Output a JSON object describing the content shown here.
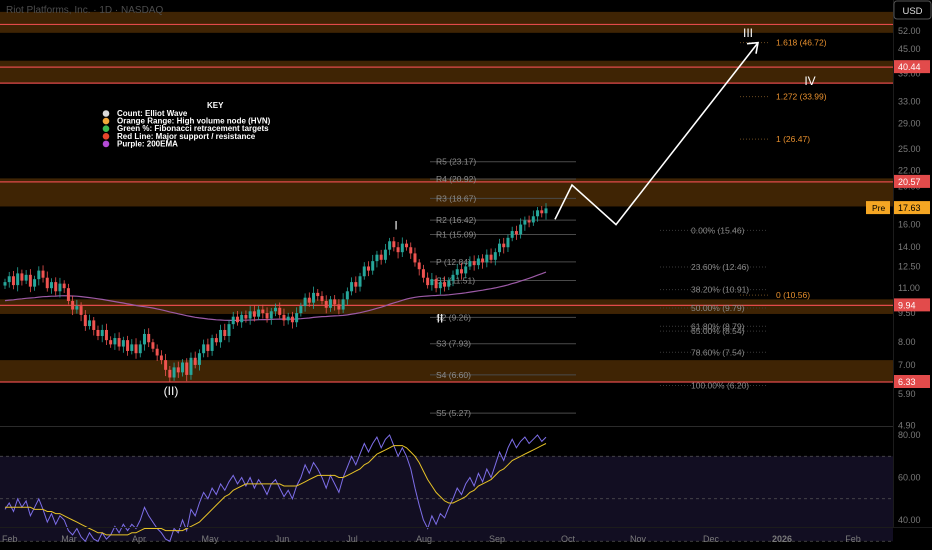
{
  "header": {
    "title": "Riot Platforms, Inc. · 1D · NASDAQ",
    "currency": "USD"
  },
  "key": {
    "title": "KEY",
    "items": [
      {
        "label": "Count: Elliot Wave",
        "color": "#d9d9d9"
      },
      {
        "label": "Orange Range: High volume node (HVN)",
        "color": "#f2a83a"
      },
      {
        "label": "Green %: Fibonacci retracement targets",
        "color": "#3fb950"
      },
      {
        "label": "Red Line: Major support / resistance",
        "color": "#e8452c"
      },
      {
        "label": "Purple: 200EMA",
        "color": "#b44ad6"
      }
    ]
  },
  "colors": {
    "background": "#000000",
    "zone_fill": "#4a2a05",
    "support_line": "#e14a4a",
    "up_candle": "#26a69a",
    "down_candle": "#ef5350",
    "ema": "#9c5aa6",
    "fib_text": "#8a8a8a",
    "ext_text": "#e8902e",
    "pivot_text": "#8c8c8c",
    "wave_text": "#ffffff",
    "rsi_line": "#7d6ee8",
    "rsi_ma": "#e6c227",
    "rsi_band": "#140f26"
  },
  "chart_data": {
    "type": "candlestick",
    "y_scale": "log",
    "ylim": [
      4.3,
      56
    ],
    "x_ticks": [
      "Feb",
      "Mar",
      "Apr",
      "May",
      "Jun",
      "Jul",
      "Aug",
      "Sep",
      "Oct",
      "Nov",
      "Dec",
      "2026",
      "Feb"
    ],
    "y_ticks": [
      50.0,
      45.0,
      39.0,
      33.0,
      29.0,
      25.0,
      22.0,
      20.0,
      17.5,
      16.0,
      14.0,
      12.5,
      11.0,
      9.5,
      8.0,
      7.0,
      5.9,
      4.9
    ],
    "y_tick_labels": [
      "52.00",
      "45.00",
      "39.00",
      "33.00",
      "29.00",
      "25.00",
      "22.00",
      "20.00",
      "17.50",
      "16.00",
      "14.00",
      "12.50",
      "11.00",
      "9.50",
      "8.00",
      "7.00",
      "5.90",
      "4.90"
    ],
    "price_tags": [
      {
        "label": "40.44",
        "value": 40.44,
        "kind": "level"
      },
      {
        "label": "20.57",
        "value": 20.57,
        "kind": "level"
      },
      {
        "label": "17.63",
        "value": 17.63,
        "kind": "pre",
        "prefix": "Pre"
      },
      {
        "label": "9.94",
        "value": 9.94,
        "kind": "level"
      },
      {
        "label": "6.33",
        "value": 6.33,
        "kind": "level"
      }
    ],
    "hvn_zones": [
      [
        49.5,
        56.0
      ],
      [
        36.8,
        42.0
      ],
      [
        17.8,
        21.0
      ],
      [
        9.45,
        10.3
      ],
      [
        6.33,
        7.2
      ]
    ],
    "support_lines": [
      52.0,
      40.44,
      36.8,
      20.57,
      9.94,
      6.33
    ],
    "pivots": [
      {
        "label": "R5 (23.17)",
        "value": 23.17
      },
      {
        "label": "R4 (20.92)",
        "value": 20.92
      },
      {
        "label": "R3 (18.67)",
        "value": 18.67
      },
      {
        "label": "R2 (16.42)",
        "value": 16.42
      },
      {
        "label": "R1 (15.09)",
        "value": 15.09
      },
      {
        "label": "P (12.84)",
        "value": 12.84
      },
      {
        "label": "S1 (11.51)",
        "value": 11.51
      },
      {
        "label": "S2 (9.26)",
        "value": 9.26
      },
      {
        "label": "S3 (7.93)",
        "value": 7.93
      },
      {
        "label": "S4 (6.60)",
        "value": 6.6
      },
      {
        "label": "S5 (5.27)",
        "value": 5.27
      }
    ],
    "fib_retracements": [
      {
        "label": "0.00% (15.46)",
        "value": 15.46
      },
      {
        "label": "23.60% (12.46)",
        "value": 12.46
      },
      {
        "label": "38.20% (10.91)",
        "value": 10.91
      },
      {
        "label": "50.00% (9.79)",
        "value": 9.79
      },
      {
        "label": "61.80% (8.79)",
        "value": 8.79
      },
      {
        "label": "65.00% (8.54)",
        "value": 8.54
      },
      {
        "label": "78.60% (7.54)",
        "value": 7.54
      },
      {
        "label": "100.00% (6.20)",
        "value": 6.2
      }
    ],
    "fib_extensions": [
      {
        "label": "1.618 (46.72)",
        "value": 46.72
      },
      {
        "label": "1.272 (33.99)",
        "value": 33.99
      },
      {
        "label": "1 (26.47)",
        "value": 26.47
      },
      {
        "label": "0 (10.56)",
        "value": 10.56
      }
    ],
    "wave_labels": [
      {
        "label": "(II)",
        "x": "Apr",
        "value": 6.0
      },
      {
        "label": "I",
        "x": "Jul",
        "value": 15.9
      },
      {
        "label": "II",
        "x": "Aug",
        "value": 9.2
      },
      {
        "label": "III",
        "x": "Nov",
        "value": 49.5
      },
      {
        "label": "IV",
        "x": "Dec",
        "value": 37.3
      }
    ],
    "projection_path": [
      {
        "x": "Sep",
        "value": 16.5
      },
      {
        "x": "Oct",
        "value": 20.2
      },
      {
        "x": "Oct",
        "value": 16.0
      },
      {
        "x": "Nov",
        "value": 46.7
      }
    ],
    "candles_close": [
      11.4,
      11.8,
      11.2,
      12.0,
      11.5,
      11.9,
      11.1,
      11.6,
      12.2,
      11.7,
      11.0,
      11.4,
      10.8,
      11.3,
      11.0,
      10.2,
      9.7,
      9.9,
      9.4,
      8.8,
      9.1,
      8.6,
      8.3,
      8.6,
      8.1,
      7.9,
      8.2,
      7.8,
      8.1,
      7.6,
      7.9,
      7.5,
      7.9,
      8.4,
      8.0,
      7.7,
      7.4,
      7.2,
      6.8,
      6.5,
      6.9,
      6.7,
      7.1,
      6.6,
      7.3,
      7.0,
      7.5,
      7.9,
      7.6,
      8.2,
      8.0,
      8.6,
      8.3,
      8.9,
      9.3,
      9.0,
      9.4,
      9.2,
      9.6,
      9.3,
      9.7,
      9.5,
      9.2,
      9.6,
      9.8,
      9.4,
      9.1,
      9.3,
      9.0,
      9.5,
      9.9,
      10.4,
      10.1,
      10.7,
      10.5,
      10.2,
      9.8,
      10.3,
      10.0,
      9.7,
      10.3,
      10.8,
      11.4,
      11.1,
      11.8,
      12.5,
      12.2,
      12.9,
      13.4,
      13.0,
      13.8,
      14.5,
      14.0,
      13.6,
      14.3,
      14.0,
      13.5,
      12.8,
      12.3,
      11.7,
      11.2,
      11.6,
      11.0,
      11.4,
      11.1,
      11.5,
      11.9,
      12.3,
      12.0,
      12.5,
      12.9,
      12.6,
      13.1,
      12.8,
      13.4,
      13.0,
      13.6,
      14.3,
      14.0,
      14.8,
      15.4,
      15.1,
      16.0,
      16.4,
      16.2,
      16.8,
      17.4,
      17.1,
      17.6
    ]
  },
  "rsi": {
    "levels": [
      {
        "label": "80.00",
        "value": 80
      },
      {
        "label": "60.00",
        "value": 60
      },
      {
        "label": "40.00",
        "value": 40
      }
    ],
    "values": [
      45,
      48,
      44,
      50,
      46,
      49,
      42,
      46,
      50,
      45,
      39,
      43,
      38,
      42,
      40,
      35,
      33,
      36,
      32,
      30,
      34,
      31,
      30,
      34,
      31,
      33,
      37,
      34,
      38,
      35,
      38,
      36,
      40,
      46,
      42,
      39,
      36,
      34,
      31,
      30,
      36,
      34,
      40,
      35,
      45,
      42,
      48,
      53,
      50,
      55,
      52,
      57,
      54,
      58,
      61,
      57,
      60,
      56,
      60,
      55,
      59,
      56,
      52,
      57,
      59,
      55,
      51,
      54,
      50,
      56,
      60,
      66,
      62,
      67,
      64,
      60,
      55,
      61,
      57,
      53,
      60,
      65,
      70,
      66,
      71,
      76,
      72,
      76,
      79,
      74,
      78,
      80,
      75,
      70,
      74,
      70,
      64,
      55,
      47,
      40,
      36,
      42,
      38,
      43,
      41,
      46,
      50,
      55,
      52,
      57,
      60,
      56,
      62,
      58,
      64,
      60,
      66,
      72,
      68,
      74,
      78,
      74,
      77,
      79,
      76,
      78,
      80,
      77,
      79
    ],
    "ma": [
      46,
      46,
      46,
      46,
      46,
      46,
      46,
      45,
      45,
      45,
      44,
      44,
      43,
      43,
      42,
      41,
      40,
      39,
      38,
      37,
      36,
      35,
      34,
      34,
      33,
      33,
      33,
      33,
      33,
      33,
      34,
      34,
      35,
      36,
      36,
      36,
      36,
      36,
      35,
      35,
      35,
      35,
      35,
      36,
      37,
      38,
      39,
      41,
      43,
      45,
      47,
      49,
      51,
      52,
      54,
      55,
      56,
      57,
      57,
      57,
      57,
      57,
      57,
      57,
      57,
      57,
      56,
      56,
      56,
      56,
      57,
      58,
      59,
      60,
      61,
      61,
      61,
      61,
      61,
      60,
      60,
      61,
      62,
      63,
      64,
      66,
      67,
      69,
      71,
      72,
      73,
      74,
      75,
      75,
      75,
      74,
      72,
      70,
      67,
      63,
      59,
      56,
      53,
      51,
      49,
      48,
      48,
      49,
      50,
      51,
      53,
      54,
      56,
      57,
      58,
      59,
      61,
      63,
      64,
      66,
      68,
      69,
      70,
      71,
      72,
      73,
      74,
      75,
      76
    ]
  }
}
